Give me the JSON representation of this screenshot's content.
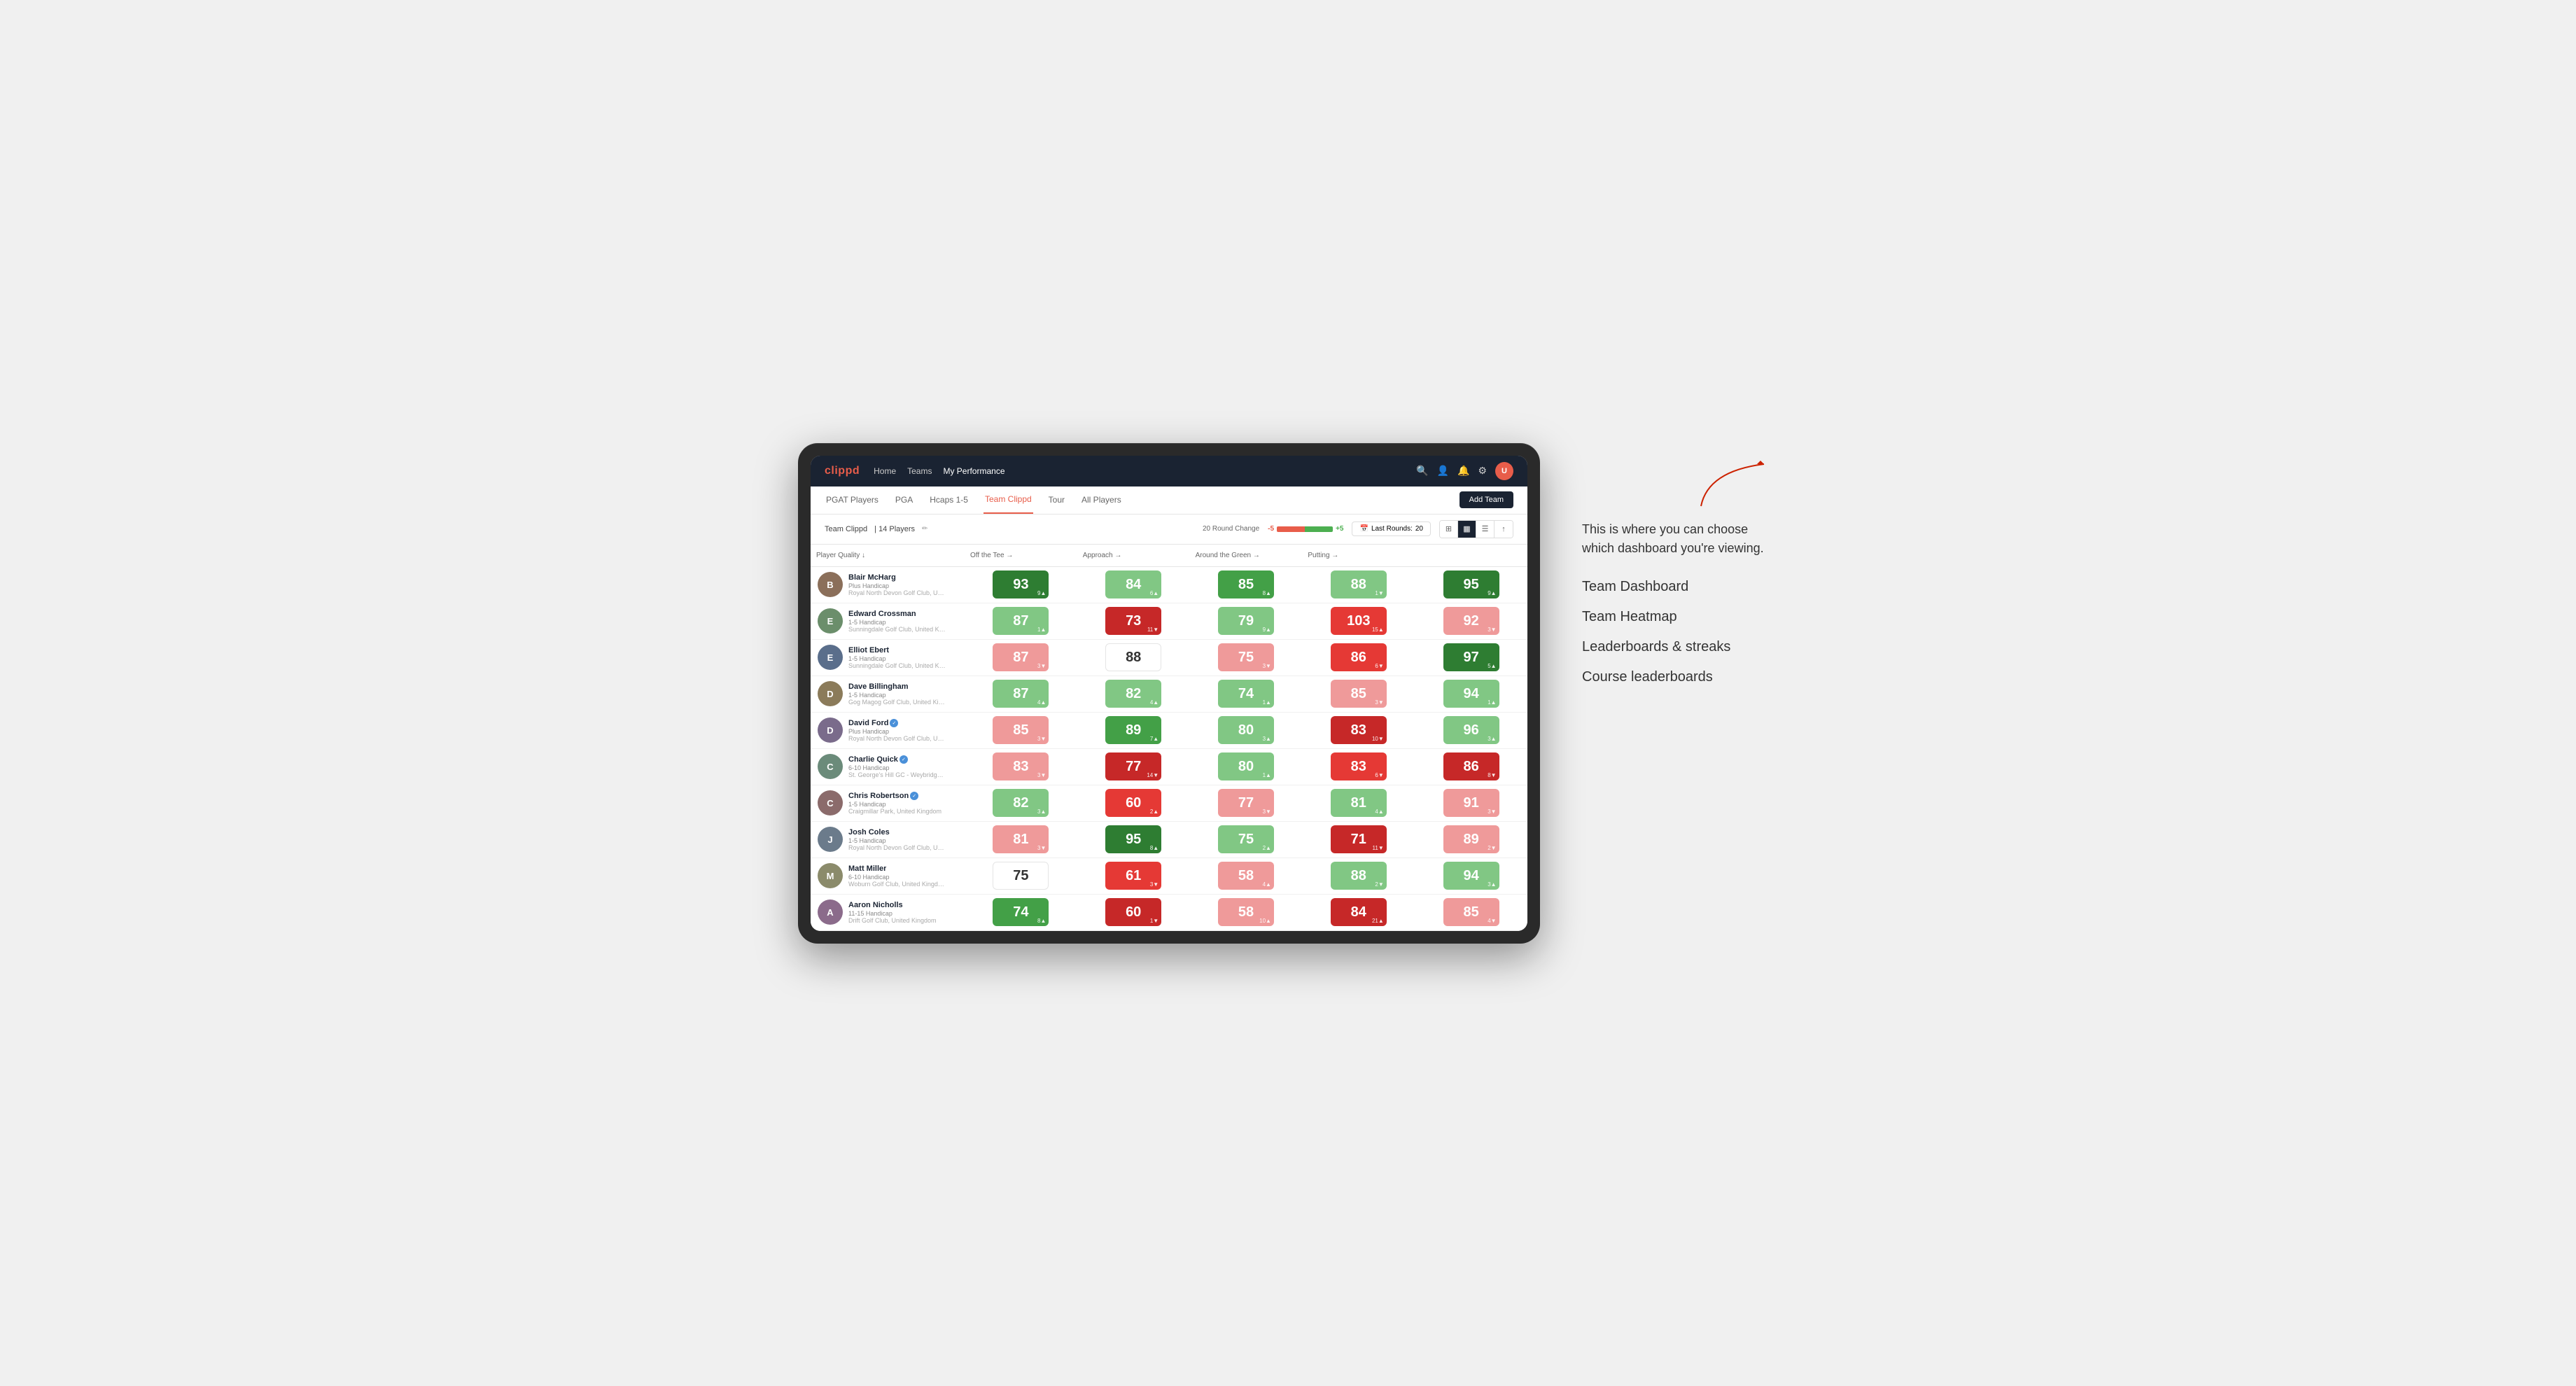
{
  "annotation": {
    "intro": "This is where you can choose which dashboard you're viewing.",
    "items": [
      "Team Dashboard",
      "Team Heatmap",
      "Leaderboards & streaks",
      "Course leaderboards"
    ]
  },
  "nav": {
    "logo": "clippd",
    "links": [
      "Home",
      "Teams",
      "My Performance"
    ],
    "active_link": "My Performance"
  },
  "sub_nav": {
    "links": [
      "PGAT Players",
      "PGA",
      "Hcaps 1-5",
      "Team Clippd",
      "Tour",
      "All Players"
    ],
    "active": "Team Clippd",
    "add_button": "Add Team"
  },
  "team_header": {
    "name": "Team Clippd",
    "count": "14 Players",
    "round_change_label": "20 Round Change",
    "neg": "-5",
    "pos": "+5",
    "last_rounds_label": "Last Rounds:",
    "last_rounds_value": "20"
  },
  "table": {
    "columns": [
      "Player Quality ↓",
      "Off the Tee →",
      "Approach →",
      "Around the Green →",
      "Putting →"
    ],
    "players": [
      {
        "name": "Blair McHarg",
        "handicap": "Plus Handicap",
        "club": "Royal North Devon Golf Club, United Kingdom",
        "color_initial": "B",
        "avatar_bg": "#8B6F5A",
        "scores": [
          {
            "value": "93",
            "delta": "9▲",
            "color": "green-dark"
          },
          {
            "value": "84",
            "delta": "6▲",
            "color": "green-light"
          },
          {
            "value": "85",
            "delta": "8▲",
            "color": "green-med"
          },
          {
            "value": "88",
            "delta": "1▼",
            "color": "green-light"
          },
          {
            "value": "95",
            "delta": "9▲",
            "color": "green-dark"
          }
        ]
      },
      {
        "name": "Edward Crossman",
        "handicap": "1-5 Handicap",
        "club": "Sunningdale Golf Club, United Kingdom",
        "color_initial": "E",
        "avatar_bg": "#6B8E6B",
        "scores": [
          {
            "value": "87",
            "delta": "1▲",
            "color": "green-light"
          },
          {
            "value": "73",
            "delta": "11▼",
            "color": "red-dark"
          },
          {
            "value": "79",
            "delta": "9▲",
            "color": "green-light"
          },
          {
            "value": "103",
            "delta": "15▲",
            "color": "red-med"
          },
          {
            "value": "92",
            "delta": "3▼",
            "color": "red-light"
          }
        ]
      },
      {
        "name": "Elliot Ebert",
        "handicap": "1-5 Handicap",
        "club": "Sunningdale Golf Club, United Kingdom",
        "color_initial": "E",
        "avatar_bg": "#5A6E8B",
        "scores": [
          {
            "value": "87",
            "delta": "3▼",
            "color": "red-light"
          },
          {
            "value": "88",
            "delta": "",
            "color": "neutral"
          },
          {
            "value": "75",
            "delta": "3▼",
            "color": "red-light"
          },
          {
            "value": "86",
            "delta": "6▼",
            "color": "red-med"
          },
          {
            "value": "97",
            "delta": "5▲",
            "color": "green-dark"
          }
        ]
      },
      {
        "name": "Dave Billingham",
        "handicap": "1-5 Handicap",
        "club": "Gog Magog Golf Club, United Kingdom",
        "color_initial": "D",
        "avatar_bg": "#8B7B5A",
        "scores": [
          {
            "value": "87",
            "delta": "4▲",
            "color": "green-light"
          },
          {
            "value": "82",
            "delta": "4▲",
            "color": "green-light"
          },
          {
            "value": "74",
            "delta": "1▲",
            "color": "green-light"
          },
          {
            "value": "85",
            "delta": "3▼",
            "color": "red-light"
          },
          {
            "value": "94",
            "delta": "1▲",
            "color": "green-light"
          }
        ]
      },
      {
        "name": "David Ford",
        "handicap": "Plus Handicap",
        "club": "Royal North Devon Golf Club, United Kingdom",
        "color_initial": "D",
        "avatar_bg": "#7A6B8B",
        "verified": true,
        "scores": [
          {
            "value": "85",
            "delta": "3▼",
            "color": "red-light"
          },
          {
            "value": "89",
            "delta": "7▲",
            "color": "green-med"
          },
          {
            "value": "80",
            "delta": "3▲",
            "color": "green-light"
          },
          {
            "value": "83",
            "delta": "10▼",
            "color": "red-dark"
          },
          {
            "value": "96",
            "delta": "3▲",
            "color": "green-light"
          }
        ]
      },
      {
        "name": "Charlie Quick",
        "handicap": "6-10 Handicap",
        "club": "St. George's Hill GC - Weybridge - Surrey, Uni...",
        "color_initial": "C",
        "avatar_bg": "#6B8B7A",
        "verified": true,
        "scores": [
          {
            "value": "83",
            "delta": "3▼",
            "color": "red-light"
          },
          {
            "value": "77",
            "delta": "14▼",
            "color": "red-dark"
          },
          {
            "value": "80",
            "delta": "1▲",
            "color": "green-light"
          },
          {
            "value": "83",
            "delta": "6▼",
            "color": "red-med"
          },
          {
            "value": "86",
            "delta": "8▼",
            "color": "red-dark"
          }
        ]
      },
      {
        "name": "Chris Robertson",
        "handicap": "1-5 Handicap",
        "club": "Craigmillar Park, United Kingdom",
        "color_initial": "C",
        "avatar_bg": "#8B6B6B",
        "verified": true,
        "scores": [
          {
            "value": "82",
            "delta": "3▲",
            "color": "green-light"
          },
          {
            "value": "60",
            "delta": "2▲",
            "color": "red-med"
          },
          {
            "value": "77",
            "delta": "3▼",
            "color": "red-light"
          },
          {
            "value": "81",
            "delta": "4▲",
            "color": "green-light"
          },
          {
            "value": "91",
            "delta": "3▼",
            "color": "red-light"
          }
        ]
      },
      {
        "name": "Josh Coles",
        "handicap": "1-5 Handicap",
        "club": "Royal North Devon Golf Club, United Kingdom",
        "color_initial": "J",
        "avatar_bg": "#6B7B8B",
        "scores": [
          {
            "value": "81",
            "delta": "3▼",
            "color": "red-light"
          },
          {
            "value": "95",
            "delta": "8▲",
            "color": "green-dark"
          },
          {
            "value": "75",
            "delta": "2▲",
            "color": "green-light"
          },
          {
            "value": "71",
            "delta": "11▼",
            "color": "red-dark"
          },
          {
            "value": "89",
            "delta": "2▼",
            "color": "red-light"
          }
        ]
      },
      {
        "name": "Matt Miller",
        "handicap": "6-10 Handicap",
        "club": "Woburn Golf Club, United Kingdom",
        "color_initial": "M",
        "avatar_bg": "#8B8B6B",
        "scores": [
          {
            "value": "75",
            "delta": "",
            "color": "neutral"
          },
          {
            "value": "61",
            "delta": "3▼",
            "color": "red-med"
          },
          {
            "value": "58",
            "delta": "4▲",
            "color": "red-light"
          },
          {
            "value": "88",
            "delta": "2▼",
            "color": "green-light"
          },
          {
            "value": "94",
            "delta": "3▲",
            "color": "green-light"
          }
        ]
      },
      {
        "name": "Aaron Nicholls",
        "handicap": "11-15 Handicap",
        "club": "Drift Golf Club, United Kingdom",
        "color_initial": "A",
        "avatar_bg": "#8B6B8B",
        "scores": [
          {
            "value": "74",
            "delta": "8▲",
            "color": "green-med"
          },
          {
            "value": "60",
            "delta": "1▼",
            "color": "red-dark"
          },
          {
            "value": "58",
            "delta": "10▲",
            "color": "red-light"
          },
          {
            "value": "84",
            "delta": "21▲",
            "color": "red-dark"
          },
          {
            "value": "85",
            "delta": "4▼",
            "color": "red-light"
          }
        ]
      }
    ]
  }
}
